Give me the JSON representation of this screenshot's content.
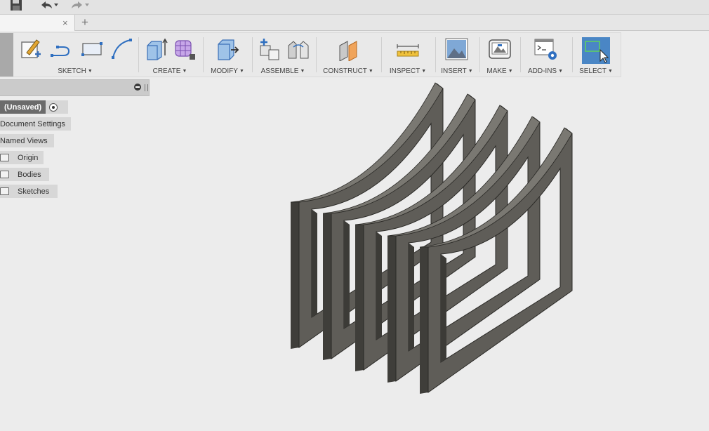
{
  "quick_access": {
    "save_icon": "save-icon",
    "undo_icon": "undo-icon",
    "redo_icon": "redo-icon"
  },
  "document_tab": {
    "close_glyph": "×",
    "new_tab_glyph": "+"
  },
  "toolbar": {
    "groups": [
      {
        "label": "SKETCH"
      },
      {
        "label": "CREATE"
      },
      {
        "label": "MODIFY"
      },
      {
        "label": "ASSEMBLE"
      },
      {
        "label": "CONSTRUCT"
      },
      {
        "label": "INSPECT"
      },
      {
        "label": "INSERT"
      },
      {
        "label": "MAKE"
      },
      {
        "label": "ADD-INS"
      },
      {
        "label": "SELECT"
      }
    ],
    "caret": "▼",
    "accent_color": "#4a86c5"
  },
  "browser": {
    "root_label": "(Unsaved)",
    "items": [
      {
        "label": "Document Settings"
      },
      {
        "label": "Named Views"
      },
      {
        "label": "Origin"
      },
      {
        "label": "Bodies"
      },
      {
        "label": "Sketches"
      }
    ]
  },
  "model": {
    "description": "",
    "body_color": "#5f5d58"
  }
}
